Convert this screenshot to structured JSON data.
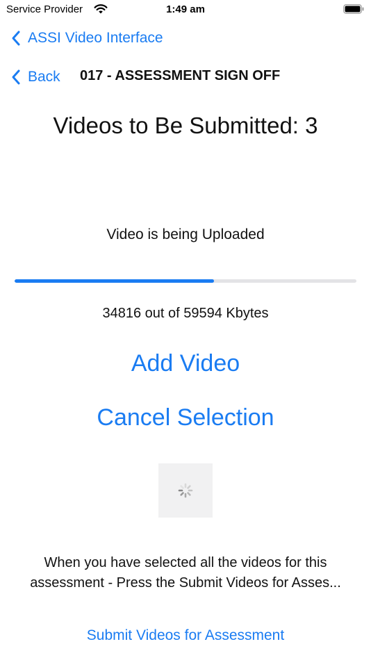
{
  "status_bar": {
    "carrier": "Service Provider",
    "time": "1:49 am",
    "icons": [
      "wifi-icon",
      "battery-icon"
    ]
  },
  "nav": {
    "top_back_label": "ASSI Video Interface",
    "back_label": "Back",
    "title": "017 - ASSESSMENT SIGN OFF"
  },
  "main": {
    "videos_count_text": "Videos to Be Submitted: 3",
    "upload_status": "Video is being Uploaded",
    "progress": {
      "uploaded_kbytes": 34816,
      "total_kbytes": 59594,
      "fraction": 0.5842
    },
    "kbytes_text": "34816 out of 59594 Kbytes",
    "add_video_label": "Add Video",
    "cancel_selection_label": "Cancel Selection",
    "spinner_icon": "activity-spinner-icon",
    "instructions_line1": "When you have selected all the videos for this",
    "instructions_line2": "assessment - Press the Submit Videos for Asses...",
    "submit_label": "Submit Videos for Assessment"
  },
  "colors": {
    "accent": "#1a7cf2",
    "track": "#e3e3e6",
    "spinner_bg": "#f1f1f2"
  }
}
